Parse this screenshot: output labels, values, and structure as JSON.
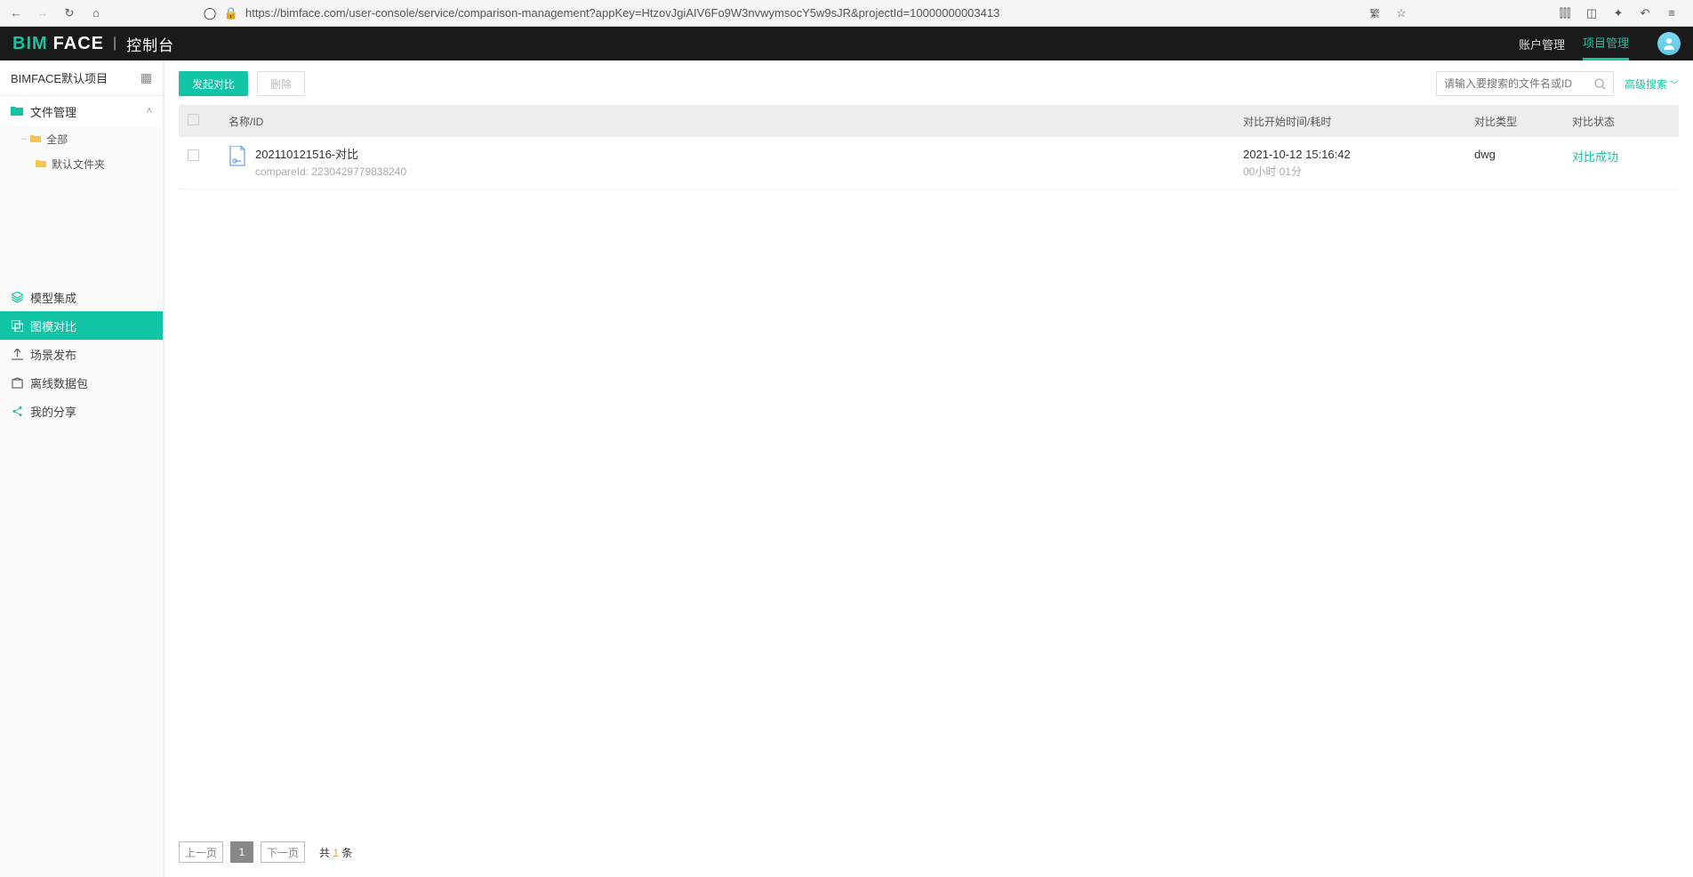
{
  "browser": {
    "url": "https://bimface.com/user-console/service/comparison-management?appKey=HtzovJgiAIV6Fo9W3nvwymsocY5w9sJR&projectId=10000000003413"
  },
  "header": {
    "logo_bim": "BIM",
    "logo_face": "FACE",
    "logo_console": "控制台",
    "nav_account": "账户管理",
    "nav_project": "项目管理"
  },
  "sidebar": {
    "project_name": "BIMFACE默认项目",
    "file_mgmt": "文件管理",
    "tree_all": "全部",
    "tree_default_folder": "默认文件夹",
    "model_integrate": "模型集成",
    "model_compare": "图模对比",
    "scene_publish": "场景发布",
    "offline_data": "离线数据包",
    "my_share": "我的分享"
  },
  "toolbar": {
    "start_compare": "发起对比",
    "delete": "删除",
    "search_placeholder": "请输入要搜索的文件名或ID",
    "adv_search": "高级搜索"
  },
  "table": {
    "h_name": "名称/ID",
    "h_time": "对比开始时间/耗时",
    "h_type": "对比类型",
    "h_status": "对比状态",
    "rows": [
      {
        "name": "202110121516-对比",
        "compare_label": "compareId: ",
        "compare_id": "2230429779838240",
        "time": "2021-10-12 15:16:42",
        "duration": "00小时 01分",
        "type": "dwg",
        "status": "对比成功"
      }
    ]
  },
  "pager": {
    "prev": "上一页",
    "current": "1",
    "next": "下一页",
    "total_prefix": "共 ",
    "total_num": "1",
    "total_suffix": " 条"
  }
}
